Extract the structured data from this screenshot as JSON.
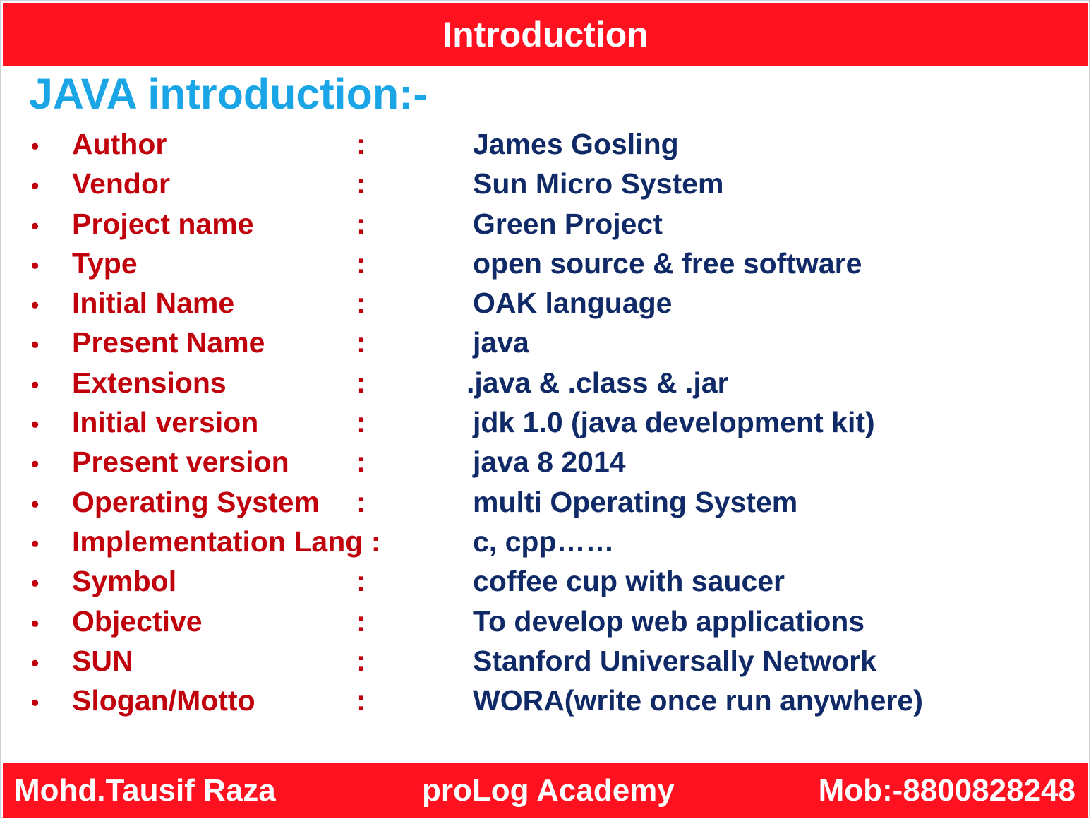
{
  "header": {
    "title": "Introduction"
  },
  "main": {
    "title": "JAVA introduction:-",
    "rows": [
      {
        "label": "Author",
        "colon": ":",
        "value": "James Gosling"
      },
      {
        "label": "Vendor",
        "colon": ":",
        "value": "Sun Micro System"
      },
      {
        "label": "Project name",
        "colon": ":",
        "value": "Green Project"
      },
      {
        "label": "Type",
        "colon": ":",
        "value": "open source & free software"
      },
      {
        "label": "Initial Name",
        "colon": ":",
        "value": "OAK language"
      },
      {
        "label": "Present Name",
        "colon": ":",
        "value": "java"
      },
      {
        "label": "Extensions",
        "colon": ":",
        "value": ".java & .class & .jar"
      },
      {
        "label": "Initial version",
        "colon": ":",
        "value": "jdk 1.0 (java development kit)"
      },
      {
        "label": "Present version",
        "colon": ":",
        "value": "java 8 2014"
      },
      {
        "label": "Operating System",
        "colon": ":",
        "value": "multi Operating System"
      },
      {
        "label": "Implementation Lang :",
        "colon": "",
        "value": "c, cpp……"
      },
      {
        "label": "Symbol",
        "colon": ":",
        "value": "coffee cup with saucer"
      },
      {
        "label": "Objective",
        "colon": ":",
        "value": "To develop web applications"
      },
      {
        "label": "SUN",
        "colon": ":",
        "value": "Stanford Universally Network"
      },
      {
        "label": "Slogan/Motto",
        "colon": ":",
        "value": "WORA(write once run anywhere)"
      }
    ]
  },
  "footer": {
    "left": "Mohd.Tausif Raza",
    "middle": "proLog Academy",
    "right": "Mob:-8800828248"
  },
  "colors": {
    "banner": "#ff1120",
    "title": "#1aa6e6",
    "label": "#c0000b",
    "value": "#0f2a66"
  }
}
